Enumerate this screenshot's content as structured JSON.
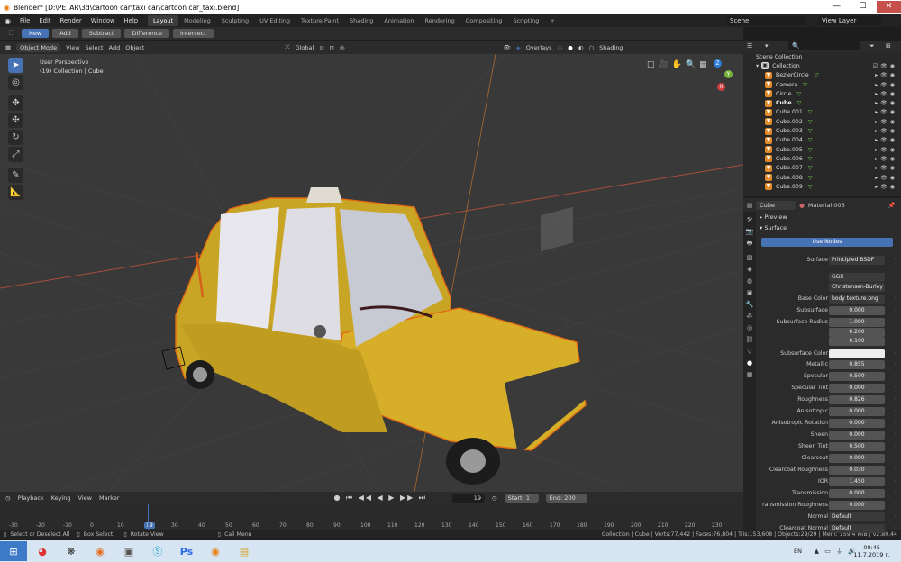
{
  "window": {
    "title": "Blender* [D:\\PETAR\\3d\\cartoon car\\taxi car\\cartoon car_taxi.blend]",
    "minimize": "—",
    "maximize": "☐",
    "close": "✕"
  },
  "menu": {
    "items": [
      "File",
      "Edit",
      "Render",
      "Window",
      "Help"
    ],
    "workspaces": [
      "Layout",
      "Modeling",
      "Sculpting",
      "UV Editing",
      "Texture Paint",
      "Shading",
      "Animation",
      "Rendering",
      "Compositing",
      "Scripting",
      "+"
    ],
    "scene": "Scene",
    "view_layer": "View Layer"
  },
  "tool_header": {
    "buttons": [
      "New",
      "Add",
      "Subtract",
      "Difference",
      "Intersect"
    ]
  },
  "viewport_header": {
    "mode": "Object Mode",
    "items": [
      "View",
      "Select",
      "Add",
      "Object"
    ],
    "orientation": "Global",
    "overlays": "Overlays",
    "shading": "Shading"
  },
  "viewport": {
    "perspective": "User Perspective",
    "collection": "(19) Collection | Cube",
    "gizmo": {
      "x": "X",
      "y": "Y",
      "z": "Z"
    }
  },
  "timeline": {
    "items": [
      "Playback",
      "Keying",
      "View",
      "Marker"
    ],
    "current_frame": "19",
    "start_label": "Start:",
    "start": "1",
    "end_label": "End:",
    "end": "200",
    "ruler": [
      "-30",
      "-20",
      "-10",
      "0",
      "10",
      "19",
      "30",
      "40",
      "50",
      "60",
      "70",
      "80",
      "90",
      "100",
      "110",
      "120",
      "130",
      "140",
      "150",
      "160",
      "170",
      "180",
      "190",
      "200",
      "210",
      "220",
      "230"
    ]
  },
  "status": {
    "select": "Select or Deselect All",
    "box": "Box Select",
    "rotate": "Rotate View",
    "call_menu": "Call Menu",
    "stats": "Collection | Cube | Verts:77,442 | Faces:76,804 | Tris:153,608 | Objects:29/29 | Mem: 159.4 MiB | v2.80.44"
  },
  "taskbar": {
    "lang": "EN",
    "time": "08:45",
    "date": "11.7.2019 г."
  },
  "outliner": {
    "scene_collection": "Scene Collection",
    "collection": "Collection",
    "items": [
      "BezierCircle",
      "Camera",
      "Circle",
      "Cube",
      "Cube.001",
      "Cube.002",
      "Cube.003",
      "Cube.004",
      "Cube.005",
      "Cube.006",
      "Cube.007",
      "Cube.008",
      "Cube.009"
    ]
  },
  "properties": {
    "object": "Cube",
    "material": "Material.003",
    "preview": "Preview",
    "surface_panel": "Surface",
    "use_nodes": "Use Nodes",
    "rows": [
      {
        "label": "Surface",
        "value": "Principled BSDF",
        "type": "field"
      },
      {
        "label": "",
        "value": "GGX",
        "type": "dropdown"
      },
      {
        "label": "",
        "value": "Christensen-Burley",
        "type": "dropdown"
      },
      {
        "label": "Base Color",
        "value": "body texture.png",
        "type": "field"
      },
      {
        "label": "Subsurface",
        "value": "0.000",
        "type": "num",
        "fill": 0
      },
      {
        "label": "Subsurface Radius",
        "value": "1.000",
        "type": "num",
        "fill": 0
      },
      {
        "label": "",
        "value": "0.200",
        "type": "num",
        "fill": 0
      },
      {
        "label": "",
        "value": "0.100",
        "type": "num",
        "fill": 0
      },
      {
        "label": "Subsurface Color",
        "value": "",
        "type": "color"
      },
      {
        "label": "Metallic",
        "value": "0.855",
        "type": "num",
        "fill": 0.855
      },
      {
        "label": "Specular",
        "value": "0.500",
        "type": "num",
        "fill": 0.5
      },
      {
        "label": "Specular Tint",
        "value": "0.000",
        "type": "num",
        "fill": 0
      },
      {
        "label": "Roughness",
        "value": "0.826",
        "type": "num",
        "fill": 0.826
      },
      {
        "label": "Anisotropic",
        "value": "0.000",
        "type": "num",
        "fill": 0
      },
      {
        "label": "Anisotropic Rotation",
        "value": "0.000",
        "type": "num",
        "fill": 0
      },
      {
        "label": "Sheen",
        "value": "0.000",
        "type": "num",
        "fill": 0
      },
      {
        "label": "Sheen Tint",
        "value": "0.500",
        "type": "num",
        "fill": 0.5
      },
      {
        "label": "Clearcoat",
        "value": "0.000",
        "type": "num",
        "fill": 0
      },
      {
        "label": "Clearcoat Roughness",
        "value": "0.030",
        "type": "num",
        "fill": 0.03
      },
      {
        "label": "IOR",
        "value": "1.450",
        "type": "num",
        "fill": 0
      },
      {
        "label": "Transmission",
        "value": "0.000",
        "type": "num",
        "fill": 0
      },
      {
        "label": "ransmission Roughness",
        "value": "0.000",
        "type": "num",
        "fill": 0
      },
      {
        "label": "Normal",
        "value": "Default",
        "type": "field"
      },
      {
        "label": "Clearcoat Normal",
        "value": "Default",
        "type": "field"
      }
    ]
  }
}
